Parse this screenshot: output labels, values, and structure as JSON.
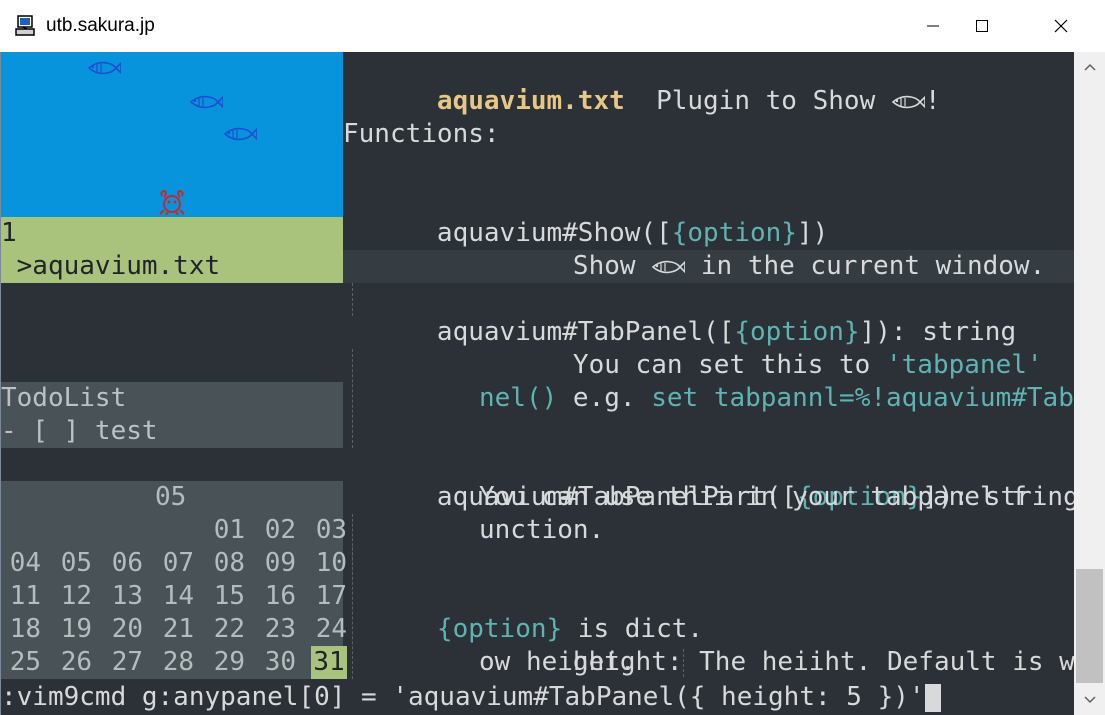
{
  "window": {
    "title": "utb.sakura.jp"
  },
  "tabpanel": {
    "tab_number": "1",
    "tab_file": " >aquavium.txt",
    "todo_title": "TodoList",
    "todo_item": "- [ ] test",
    "calendar": {
      "month": "05",
      "weeks": [
        [
          "",
          "",
          "",
          "",
          "01",
          "02",
          "03"
        ],
        [
          "04",
          "05",
          "06",
          "07",
          "08",
          "09",
          "10"
        ],
        [
          "11",
          "12",
          "13",
          "14",
          "15",
          "16",
          "17"
        ],
        [
          "18",
          "19",
          "20",
          "21",
          "22",
          "23",
          "24"
        ],
        [
          "25",
          "26",
          "27",
          "28",
          "29",
          "30",
          "31"
        ]
      ],
      "today": "31"
    }
  },
  "help": {
    "file_title": "aquavium.txt",
    "title_rest": "  Plugin to Show ",
    "title_end": "!",
    "functions_header": "Functions:",
    "show_fn": "aquavium#Show([",
    "show_opt": "{option}",
    "show_close": "])",
    "show_desc_a": "Show ",
    "show_desc_b": " in the current window.",
    "tabpanel_fn": "aquavium#TabPanel([",
    "tabpanel_opt": "{option}",
    "tabpanel_close": "]): string",
    "tabpanel_desc1_a": "You can set this to ",
    "tabpanel_desc1_b": "'tabpanel'",
    "tabpanel_desc2_a": "e.g. ",
    "tabpanel_desc2_b": "set tabpannl=%!aquavium#TabPa",
    "tabpanel_desc3": "nel()",
    "part_fn": "aquavium#TabPanelPart([",
    "part_opt": "{option}",
    "part_close": "]): string",
    "part_desc1": "You can use thii in your tabpanel f",
    "part_desc2": "unction.",
    "option_opt": "{option}",
    "option_rest": " is dict.",
    "height_key": "height:",
    "height_desc": " The heiiht. Default is wind",
    "height_desc2": "ow height."
  },
  "cmdline": ":vim9cmd g:anypanel[0] = 'aquavium#TabPanel({ height: 5 })'",
  "colors": {
    "background": "#2b3137",
    "aquarium": "#0894dd",
    "tab_highlight": "#a9c37d",
    "title": "#e6c785",
    "link": "#5fb3b3"
  }
}
